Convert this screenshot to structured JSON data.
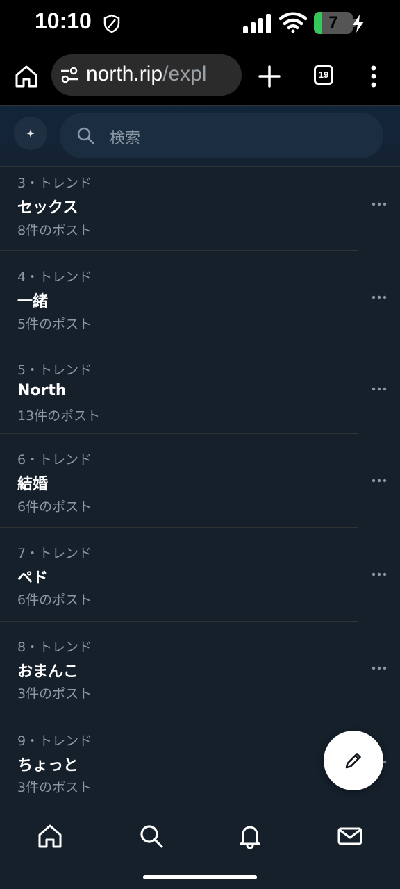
{
  "status_bar": {
    "time": "10:10",
    "battery_level": "7",
    "battery_fraction": 0.07
  },
  "browser": {
    "url_domain": "north.rip",
    "url_path": "/expl",
    "tab_count": "19"
  },
  "search": {
    "placeholder": "検索"
  },
  "trends": [
    {
      "meta": "3・トレンド",
      "name": "セックス",
      "count": "8件のポスト"
    },
    {
      "meta": "4・トレンド",
      "name": "一緒",
      "count": "5件のポスト"
    },
    {
      "meta": "5・トレンド",
      "name": "North",
      "count": "13件のポスト"
    },
    {
      "meta": "6・トレンド",
      "name": "結婚",
      "count": "6件のポスト"
    },
    {
      "meta": "7・トレンド",
      "name": "ペド",
      "count": "6件のポスト"
    },
    {
      "meta": "8・トレンド",
      "name": "おまんこ",
      "count": "3件のポスト"
    },
    {
      "meta": "9・トレンド",
      "name": "ちょっと",
      "count": "3件のポスト"
    }
  ],
  "icons": {
    "compose": "pencil-icon",
    "nav": [
      "home-icon",
      "search-icon",
      "bell-icon",
      "mail-icon"
    ]
  },
  "colors": {
    "background": "#15202b",
    "secondary_text": "#8b98a5",
    "battery_green": "#34c759"
  }
}
